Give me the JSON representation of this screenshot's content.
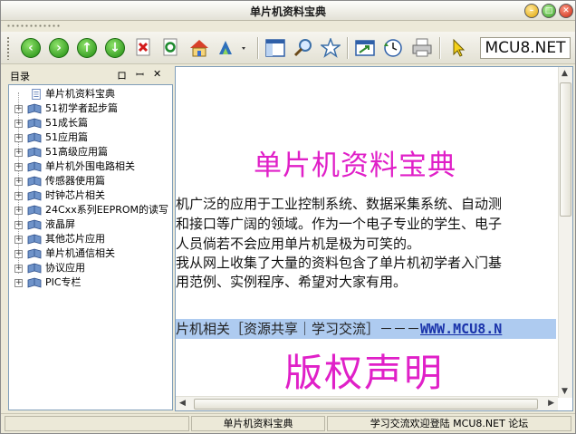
{
  "window": {
    "title": "单片机资料宝典"
  },
  "toolbar": {
    "buttons": [
      {
        "icon": "back-arrow-icon"
      },
      {
        "icon": "forward-arrow-icon"
      },
      {
        "icon": "up-arrow-icon"
      },
      {
        "icon": "down-arrow-icon"
      },
      {
        "icon": "stop-icon"
      },
      {
        "icon": "refresh-icon"
      },
      {
        "icon": "home-icon"
      },
      {
        "icon": "font-size-icon"
      },
      {
        "icon": "toggle-panel-icon"
      },
      {
        "icon": "search-icon"
      },
      {
        "icon": "favorites-star-icon"
      },
      {
        "icon": "navigate-icon"
      },
      {
        "icon": "history-icon"
      },
      {
        "icon": "print-icon"
      },
      {
        "icon": "pointer-icon"
      }
    ],
    "logo_text": "MCU8.NET"
  },
  "sidebar": {
    "title": "目录",
    "pin_label": "ロ",
    "dock_label": "ꟷ",
    "close_label": "✕",
    "root": "单片机资料宝典",
    "items": [
      {
        "label": "51初学者起步篇"
      },
      {
        "label": "51成长篇"
      },
      {
        "label": "51应用篇"
      },
      {
        "label": "51高级应用篇"
      },
      {
        "label": "单片机外围电路相关"
      },
      {
        "label": "传感器使用篇"
      },
      {
        "label": "时钟芯片相关"
      },
      {
        "label": "24Cxx系列EEPROM的读写"
      },
      {
        "label": "液晶屏"
      },
      {
        "label": "其他芯片应用"
      },
      {
        "label": "单片机通信相关"
      },
      {
        "label": "协议应用"
      },
      {
        "label": "PIC专栏"
      }
    ]
  },
  "content": {
    "heading": "单片机资料宝典",
    "lines": [
      "机广泛的应用于工业控制系统、数据采集系统、自动测",
      "和接口等广阔的领域。作为一个电子专业的学生、电子",
      "人员倘若不会应用单片机是极为可笑的。",
      "我从网上收集了大量的资料包含了单片机初学者入门基",
      "用范例、实例程序、希望对大家有用。"
    ],
    "banner_text": "片机相关［资源共享｜学习交流］－－－",
    "banner_link": "WWW.MCU8.N",
    "copyright_title": "版权声明"
  },
  "statusbar": {
    "cells": [
      "",
      "单片机资料宝典",
      "学习交流欢迎登陆 MCU8.NET 论坛"
    ]
  },
  "colors": {
    "accent_magenta": "#e020c8",
    "banner_blue": "#aecbf0",
    "link_blue": "#1a33aa"
  }
}
